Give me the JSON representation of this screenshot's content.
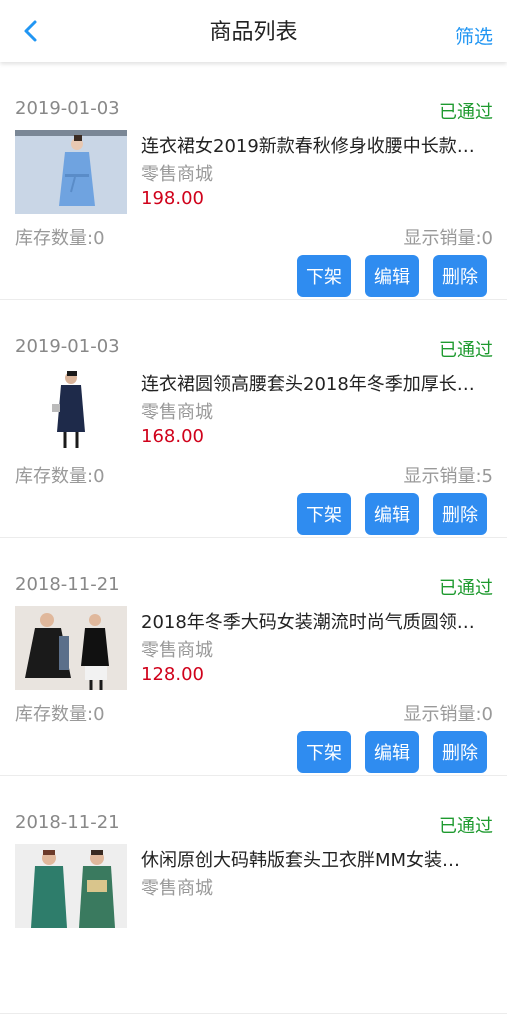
{
  "header": {
    "title": "商品列表",
    "filter_label": "筛选",
    "back_icon": "chevron-left-icon"
  },
  "colors": {
    "accent": "#2f8cf0",
    "status_green": "#1e9a2f",
    "price_red": "#d0021b"
  },
  "products": [
    {
      "date": "2019-01-03",
      "status": "已通过",
      "name": "连衣裙女2019新款春秋修身收腰中长款…",
      "shop": "零售商城",
      "price": "198.00",
      "stock_label": "库存数量:0",
      "sales_label": "显示销量:0",
      "actions": {
        "unshelve": "下架",
        "edit": "编辑",
        "delete": "删除"
      }
    },
    {
      "date": "2019-01-03",
      "status": "已通过",
      "name": "连衣裙圆领高腰套头2018年冬季加厚长…",
      "shop": "零售商城",
      "price": "168.00",
      "stock_label": "库存数量:0",
      "sales_label": "显示销量:5",
      "actions": {
        "unshelve": "下架",
        "edit": "编辑",
        "delete": "删除"
      }
    },
    {
      "date": "2018-11-21",
      "status": "已通过",
      "name": "2018年冬季大码女装潮流时尚气质圆领…",
      "shop": "零售商城",
      "price": "128.00",
      "stock_label": "库存数量:0",
      "sales_label": "显示销量:0",
      "actions": {
        "unshelve": "下架",
        "edit": "编辑",
        "delete": "删除"
      }
    },
    {
      "date": "2018-11-21",
      "status": "已通过",
      "name": "休闲原创大码韩版套头卫衣胖MM女装…",
      "shop": "零售商城"
    }
  ]
}
